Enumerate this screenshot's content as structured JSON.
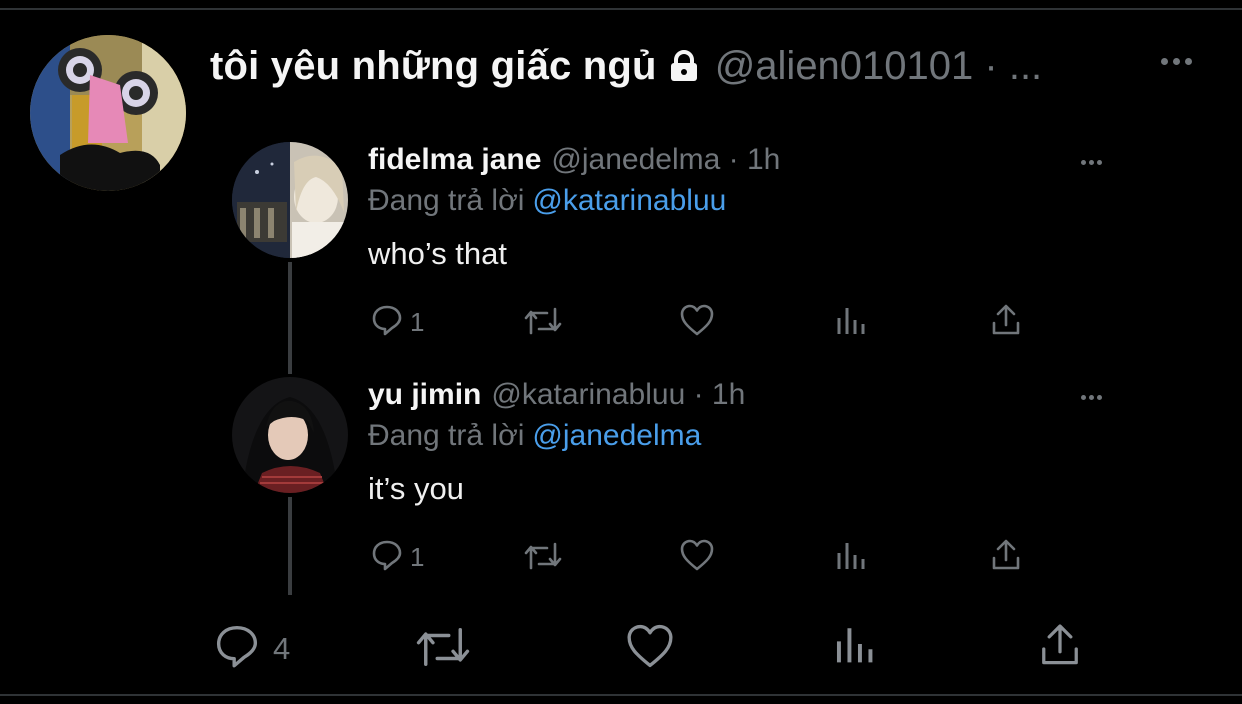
{
  "tweet": {
    "author_name": "tôi yêu những giấc ngủ",
    "author_handle": "@alien010101 · ...",
    "lock_icon": "lock-icon",
    "more_icon": "more-horizontal-icon",
    "actions": {
      "reply_count": "4",
      "icons": [
        "reply-icon",
        "retweet-icon",
        "like-icon",
        "analytics-icon",
        "share-icon"
      ]
    }
  },
  "replies": [
    {
      "name": "fidelma jane",
      "handle_time": "@janedelma · 1h",
      "replying_label": "Đang trả lời",
      "replying_to": "@katarinabluu",
      "text": "who’s that",
      "reply_count": "1"
    },
    {
      "name": "yu jimin",
      "handle_time": "@katarinabluu · 1h",
      "replying_label": "Đang trả lời",
      "replying_to": "@janedelma",
      "text": "it’s you",
      "reply_count": "1"
    }
  ],
  "colors": {
    "background": "#000000",
    "text": "#e7e9ea",
    "secondary": "#71767b",
    "mention": "#4a9eea"
  }
}
